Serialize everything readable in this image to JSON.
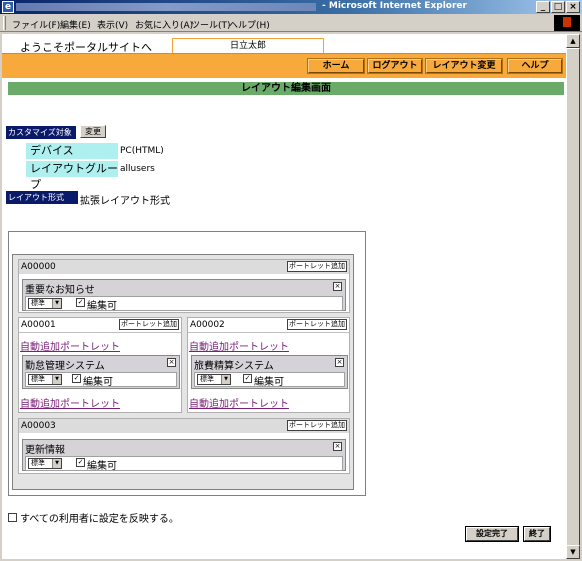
{
  "window": {
    "icon": "ie-icon",
    "title": "- Microsoft Internet Explorer",
    "controls": [
      "_",
      "□",
      "×"
    ]
  },
  "menubar": {
    "items": [
      "ファイル(F)",
      "編集(E)",
      "表示(V)",
      "お気に入り(A)",
      "ツール(T)",
      "ヘルプ(H)"
    ]
  },
  "header": {
    "welcome": "ようこそポータルサイトへ",
    "user_name": "日立太郎"
  },
  "nav": {
    "home": "ホーム",
    "logout": "ログアウト",
    "layout_change": "レイアウト変更",
    "help": "ヘルプ"
  },
  "page": {
    "title": "レイアウト編集画面"
  },
  "customize": {
    "tag": "カスタマイズ対象",
    "change_button": "変更",
    "device_label": "デバイス",
    "device_value": "PC(HTML)",
    "group_label": "レイアウトグループ",
    "group_value": "allusers"
  },
  "layout_type": {
    "tag": "レイアウト形式",
    "value": "拡張レイアウト形式"
  },
  "areas": {
    "a0": {
      "id": "A00000",
      "add": "ポートレット追加",
      "portlet": {
        "title": "重要なお知らせ",
        "select": "標準",
        "editable": "編集可",
        "close": "×"
      }
    },
    "a1": {
      "id": "A00001",
      "add": "ポートレット追加",
      "auto_top": "自動追加ポートレット",
      "portlet": {
        "title": "勤怠管理システム",
        "select": "標準",
        "editable": "編集可",
        "close": "×"
      },
      "auto_bottom": "自動追加ポートレット"
    },
    "a2": {
      "id": "A00002",
      "add": "ポートレット追加",
      "auto_top": "自動追加ポートレット",
      "portlet": {
        "title": "旅費精算システム",
        "select": "標準",
        "editable": "編集可",
        "close": "×"
      },
      "auto_bottom": "自動追加ポートレット"
    },
    "a3": {
      "id": "A00003",
      "add": "ポートレット追加",
      "portlet": {
        "title": "更新情報",
        "select": "標準",
        "editable": "編集可",
        "close": "×"
      }
    }
  },
  "footer": {
    "apply_all": "すべての利用者に設定を反映する。",
    "done": "設定完了",
    "exit": "終了"
  },
  "colors": {
    "nav_bar": "#f7a93b",
    "page_header": "#6aab6a",
    "tag": "#0a1a6a",
    "label_cyan": "#aef0f0",
    "link": "#7a1f7a"
  }
}
